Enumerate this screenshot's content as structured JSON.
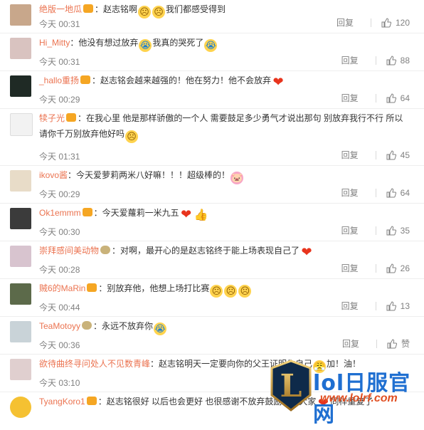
{
  "actions": {
    "reply_label": "回复"
  },
  "comments": [
    {
      "user": "绝版一地瓜",
      "text_a": "：赵志铭啊",
      "text_b": "我们都感受得到",
      "time": "今天 00:31",
      "likes": "120",
      "avatar_color": "#c8a78b"
    },
    {
      "user": "Hi_Mitty",
      "text_a": "：他没有想过放弃",
      "text_b": "我真的哭死了",
      "time": "今天 00:31",
      "likes": "88",
      "avatar_color": "#d9c3c0"
    },
    {
      "user": "_hallo重扬",
      "text_a": "：赵志铭会越来越强的！他在努力！他不会放弃",
      "time": "今天 00:29",
      "likes": "64",
      "avatar_color": "#1f2a25"
    },
    {
      "user": "犊子光",
      "text_a": "：在我心里 他是那样骄傲的一个人 需要鼓足多少勇气才说出那句 别放弃我行不行 所以",
      "text_b": "请你千万别放弃他好吗",
      "time": "今天 01:31",
      "likes": "45",
      "avatar_color": "#f2f2f2"
    },
    {
      "user": "ikovo酱",
      "text_a": "：今天爱萝莉两米八好嘛！！！超级棒的！",
      "time": "今天 00:29",
      "likes": "64",
      "avatar_color": "#e8dcc8"
    },
    {
      "user": "Ok1emmm",
      "text_a": "：今天爱蘿莉一米九五",
      "time": "今天 00:30",
      "likes": "35",
      "avatar_color": "#3b3b3b"
    },
    {
      "user": "崇拜感间美动物",
      "text_a": "：对啊，最开心的是赵志铭终于能上场表现自己了",
      "time": "今天 00:28",
      "likes": "26",
      "avatar_color": "#d8c4cf"
    },
    {
      "user": "贼6的MaRin",
      "text_a": "：别放弃他，他想上场打比赛",
      "time": "今天 00:44",
      "likes": "13",
      "avatar_color": "#5c6a4a"
    },
    {
      "user": "TeaMotoyy",
      "text_a": "：永远不放弃你",
      "time": "今天 00:36",
      "likes": "赞",
      "avatar_color": "#c9d3d8"
    },
    {
      "user": "欲待曲终寻问处人不见数青峰",
      "text_a": "：赵志铭明天一定要向你的父王证明你自己",
      "text_b": "加！油！",
      "time": "今天 03:10",
      "likes": "",
      "avatar_color": "#e0cfcf"
    },
    {
      "user": "TyangKoro1",
      "text_a": "：赵志铭很好 以后也会更好 也很感谢不放弃鼓励他的大家",
      "text_b": "同样重复了",
      "time": "",
      "likes": "",
      "avatar_color": "#f5c132"
    }
  ],
  "watermark": {
    "title": "lol日服官网",
    "url": "www.lolrf.com",
    "logo_letter": "L"
  },
  "colors": {
    "username": "#eb7350",
    "meta": "#808080",
    "watermark_blue": "#1f6fd1",
    "watermark_orange": "#e04f22"
  }
}
